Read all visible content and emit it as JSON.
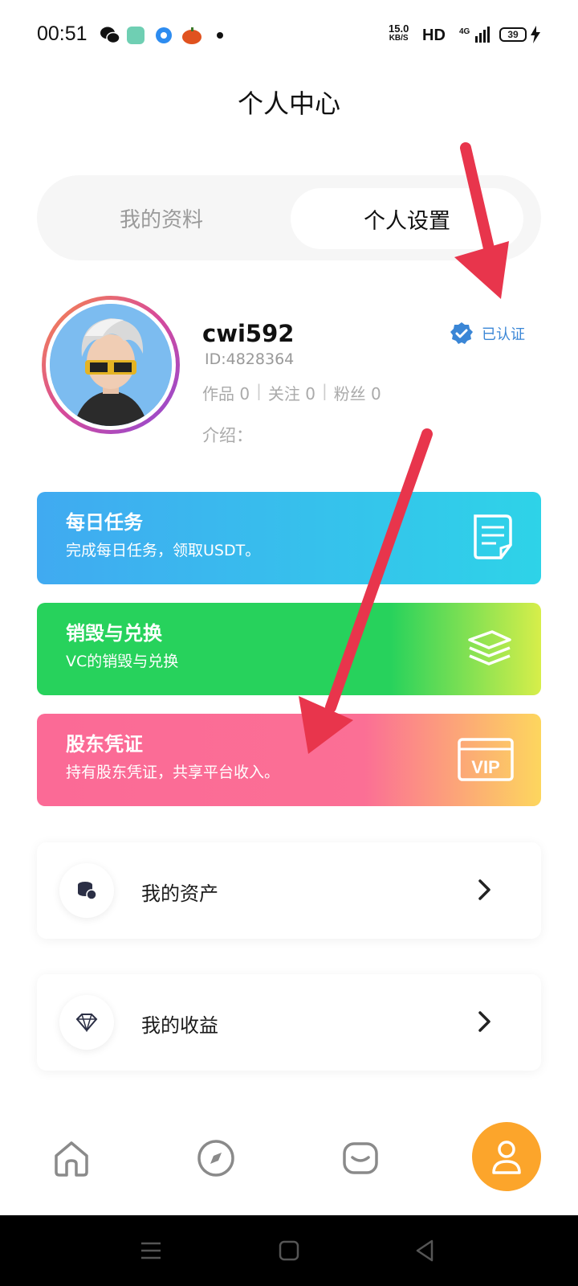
{
  "status_bar": {
    "time": "00:51",
    "net_speed": "15.0",
    "net_unit": "KB/S",
    "network": "HD",
    "signal_label": "4G",
    "battery": "39"
  },
  "page": {
    "title": "个人中心"
  },
  "tabs": [
    {
      "label": "我的资料",
      "active": false
    },
    {
      "label": "个人设置",
      "active": true
    }
  ],
  "profile": {
    "username": "cwi592",
    "id_text": "ID:4828364",
    "stats": [
      {
        "label": "作品",
        "value": "0"
      },
      {
        "label": "关注",
        "value": "0"
      },
      {
        "label": "粉丝",
        "value": "0"
      }
    ],
    "intro_label": "介绍：",
    "verified_label": "已认证"
  },
  "cards": [
    {
      "title": "每日任务",
      "subtitle": "完成每日任务，领取USDT。",
      "icon": "document-icon"
    },
    {
      "title": "销毁与兑换",
      "subtitle": "VC的销毁与兑换",
      "icon": "stack-icon"
    },
    {
      "title": "股东凭证",
      "subtitle": "持有股东凭证，共享平台收入。",
      "icon": "vip-icon",
      "icon_text": "VIP"
    }
  ],
  "list": [
    {
      "label": "我的资产",
      "icon": "coins-icon"
    },
    {
      "label": "我的收益",
      "icon": "diamond-icon"
    }
  ],
  "bottom_nav": [
    {
      "name": "home-icon",
      "active": false
    },
    {
      "name": "compass-icon",
      "active": false
    },
    {
      "name": "message-icon",
      "active": false
    },
    {
      "name": "profile-icon",
      "active": true
    }
  ],
  "colors": {
    "accent_orange": "#fca52b",
    "verified_blue": "#3a86d6",
    "annotation_red": "#e8354c"
  }
}
